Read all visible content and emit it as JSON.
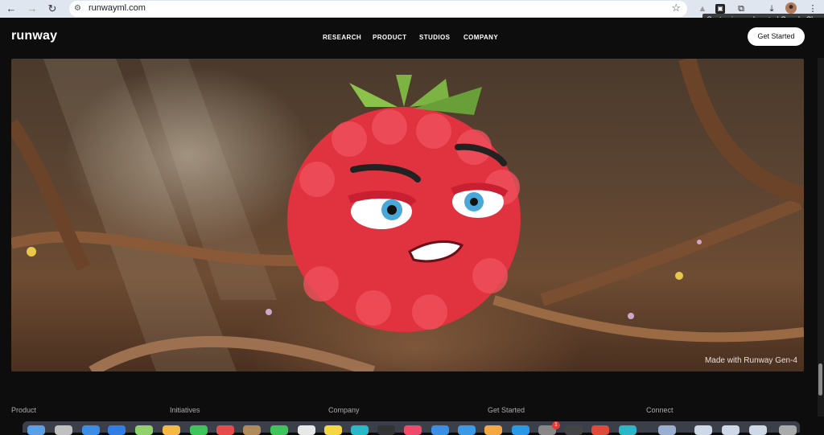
{
  "browser": {
    "url": "runwayml.com",
    "tooltip": "Customize and control Google Chrome",
    "badge_count": "1"
  },
  "site": {
    "logo": "runway",
    "nav": [
      "RESEARCH",
      "PRODUCT",
      "STUDIOS",
      "COMPANY"
    ],
    "cta_label": "Get Started"
  },
  "hero": {
    "caption": "Made with Runway Gen-4"
  },
  "footer": {
    "columns": [
      "Product",
      "Initiatives",
      "Company",
      "Get Started",
      "Connect"
    ]
  },
  "colors": {
    "page_bg": "#0d0d0d",
    "raspberry": "#e0323f",
    "leaf": "#7cb342",
    "browser_chrome": "#dfe6ef"
  }
}
